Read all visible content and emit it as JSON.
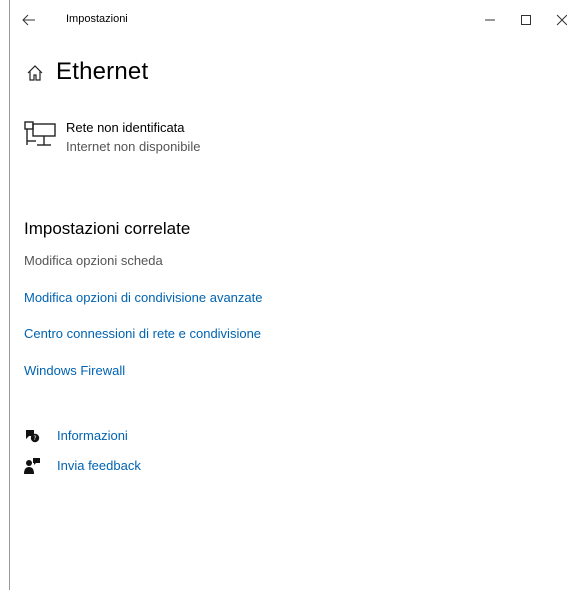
{
  "window": {
    "app_title": "Impostazioni",
    "back_icon": "arrow-left-icon",
    "controls": {
      "minimize_icon": "minimize-icon",
      "maximize_icon": "maximize-icon",
      "close_icon": "close-icon"
    }
  },
  "header": {
    "home_icon": "home-icon",
    "title": "Ethernet"
  },
  "network": {
    "icon": "ethernet-network-icon",
    "name": "Rete non identificata",
    "status": "Internet non disponibile"
  },
  "related": {
    "title": "Impostazioni correlate",
    "adapter_options": "Modifica opzioni scheda",
    "links": [
      "Modifica opzioni di condivisione avanzate",
      "Centro connessioni di rete e condivisione",
      "Windows Firewall"
    ]
  },
  "help": {
    "items": [
      {
        "label": "Informazioni",
        "icon": "chat-help-icon"
      },
      {
        "label": "Invia feedback",
        "icon": "feedback-icon"
      }
    ]
  },
  "colors": {
    "link": "#0063b1",
    "secondary_text": "#555555",
    "background": "#ffffff"
  }
}
